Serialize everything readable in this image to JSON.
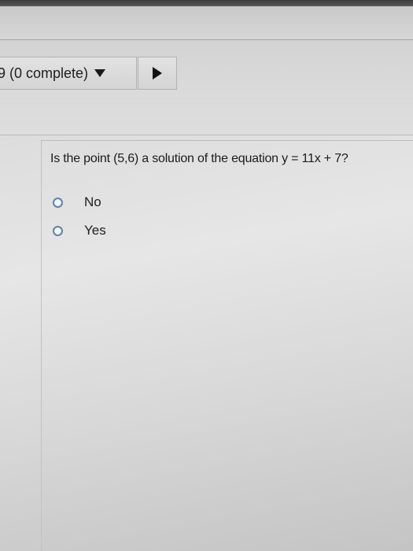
{
  "toolbar": {
    "progress_label": "9 (0 complete)",
    "dropdown_icon": "caret-down-icon",
    "next_icon": "play-right-icon"
  },
  "question": {
    "prompt": "Is the point (5,6) a solution of the equation y = 11x + 7?",
    "options": [
      {
        "label": "No",
        "selected": false
      },
      {
        "label": "Yes",
        "selected": false
      }
    ]
  },
  "colors": {
    "radio_border": "#5c84aa",
    "text": "#1c1c1c"
  }
}
